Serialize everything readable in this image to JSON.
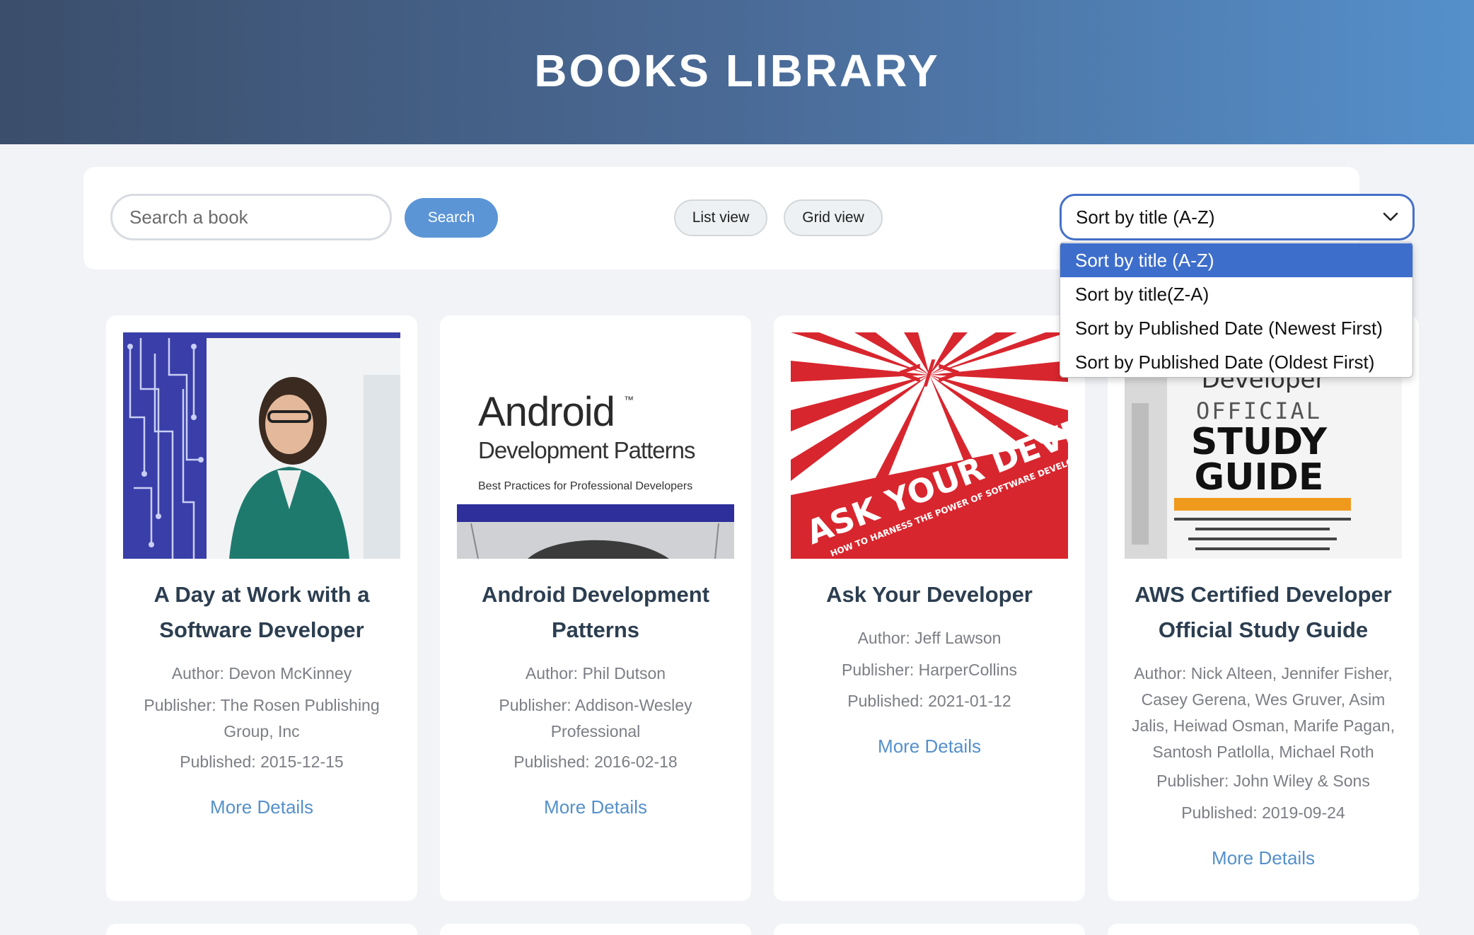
{
  "header": {
    "title": "BOOKS LIBRARY"
  },
  "toolbar": {
    "search_placeholder": "Search a book",
    "search_label": "Search",
    "list_view_label": "List view",
    "grid_view_label": "Grid view",
    "sort_selected": "Sort by title (A-Z)",
    "sort_options": [
      "Sort by title (A-Z)",
      "Sort by title(Z-A)",
      "Sort by Published Date (Newest First)",
      "Sort by Published Date (Oldest First)"
    ]
  },
  "books": [
    {
      "title_line1": "A Day at Work with a",
      "title_line2": "Software Developer",
      "author_line1": "Author: Devon McKinney",
      "publisher_line1": "Publisher: The Rosen Publishing",
      "publisher_line2": "Group, Inc",
      "published": "Published: 2015-12-15",
      "more": "More Details"
    },
    {
      "title_line1": "Android Development",
      "title_line2": "Patterns",
      "author_line1": "Author: Phil Dutson",
      "publisher_line1": "Publisher: Addison-Wesley",
      "publisher_line2": "Professional",
      "published": "Published: 2016-02-18",
      "more": "More Details",
      "cover_text": {
        "line1": "Android",
        "tm": "™",
        "line2": "Development Patterns",
        "line3": "Best Practices for Professional Developers"
      }
    },
    {
      "title_line1": "Ask Your Developer",
      "author_line1": "Author: Jeff Lawson",
      "publisher_line1": "Publisher: HarperCollins",
      "published": "Published: 2021-01-12",
      "more": "More Details",
      "cover_text": {
        "code": "</>",
        "banner": "ASK YOUR DEVELOPER",
        "sub": "HOW TO HARNESS THE POWER OF SOFTWARE DEVELOPERS"
      }
    },
    {
      "title_line1": "AWS Certified Developer",
      "title_line2": "Official Study Guide",
      "author_line1": "Author: Nick Alteen, Jennifer Fisher,",
      "author_line2": "Casey Gerena, Wes Gruver, Asim",
      "author_line3": "Jalis, Heiwad Osman, Marife Pagan,",
      "author_line4": "Santosh Patlolla, Michael Roth",
      "publisher_line1": "Publisher: John Wiley & Sons",
      "published": "Published: 2019-09-24",
      "more": "More Details",
      "cover_text": {
        "top": "Developer",
        "line1": "OFFICIAL",
        "line2": "STUDY",
        "line3": "GUIDE"
      }
    }
  ],
  "colors": {
    "header_start": "#3b4e6b",
    "header_end": "#5590cb",
    "accent": "#5b95d6",
    "link": "#5590cb",
    "select_highlight": "#3e6ecb"
  }
}
